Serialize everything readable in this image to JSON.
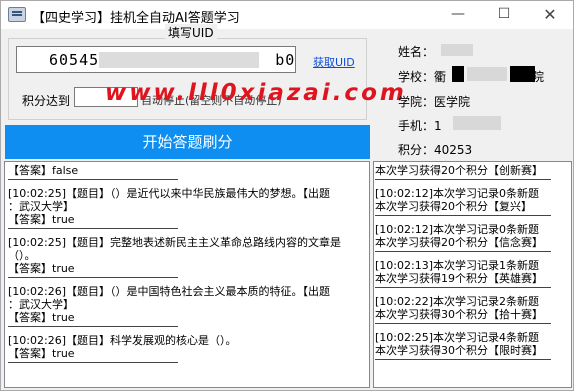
{
  "window": {
    "title": "【四史学习】挂机全自动AI答题学习",
    "minimize_glyph": "—",
    "maximize_glyph": "☐",
    "close_glyph": "✕"
  },
  "uid_section": {
    "label": "填写UID",
    "value_prefix": "605450",
    "value_suffix": "b038b",
    "fetch_link": "获取UID"
  },
  "score_target": {
    "label": "积分达到",
    "suffix_text": "自动停止(留空则不自动停止)"
  },
  "watermark": "www.lll0xiazai.com",
  "start_button": "开始答题刷分",
  "user_info": {
    "name_label": "姓名：",
    "school_label": "学校：衢",
    "school_suffix": "院",
    "college_label": "学院：医学院",
    "phone_label": "手机：1",
    "points_label": "积分：40253"
  },
  "answer_log": [
    "【答案】false",
    "[10:02:25]【题目】（）是近代以来中华民族最伟大的梦想。【出题",
    "：武汉大学】",
    "【答案】true",
    "[10:02:25]【题目】完整地表述新民主主义革命总路线内容的文章是",
    "（）。",
    "【答案】true",
    "[10:02:26]【题目】（）是中国特色社会主义最本质的特征。【出题",
    "：武汉大学】",
    "【答案】true",
    "[10:02:26]【题目】科学发展观的核心是（）。",
    "【答案】true"
  ],
  "record_log": [
    "本次学习获得20个积分【创新赛】",
    "[10:02:12]本次学习记录0条新题",
    "本次学习获得20个积分【复兴】",
    "[10:02:12]本次学习记录0条新题",
    "本次学习获得20个积分【信念赛】",
    "[10:02:13]本次学习记录1条新题",
    "本次学习获得19个积分【英雄赛】",
    "[10:02:22]本次学习记录2条新题",
    "本次学习获得30个积分【拾十赛】",
    "[10:02:25]本次学习记录4条新题",
    "本次学习获得30个积分【限时赛】"
  ]
}
